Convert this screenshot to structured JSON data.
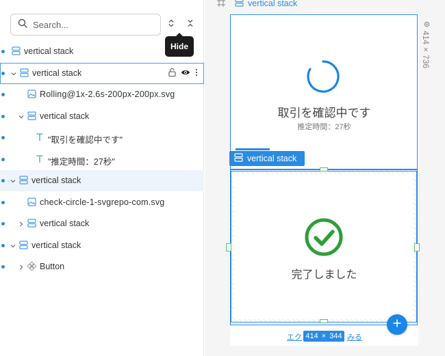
{
  "search": {
    "placeholder": "Search..."
  },
  "tooltip": "Hide",
  "tree": [
    {
      "label": "vertical stack",
      "icon": "stack-icon"
    },
    {
      "label": "vertical stack",
      "icon": "stack-icon"
    },
    {
      "label": "Rolling@1x-2.6s-200px-200px.svg",
      "icon": "image-icon"
    },
    {
      "label": "vertical stack",
      "icon": "stack-icon"
    },
    {
      "label": "\"取引を確認中です\"",
      "icon": "text-icon"
    },
    {
      "label": "\"推定時間：27秒\"",
      "icon": "text-icon"
    },
    {
      "label": "vertical stack",
      "icon": "stack-icon"
    },
    {
      "label": "check-circle-1-svgrepo-com.svg",
      "icon": "image-icon"
    },
    {
      "label": "vertical stack",
      "icon": "stack-icon"
    },
    {
      "label": "vertical stack",
      "icon": "stack-icon"
    },
    {
      "label": "Button",
      "icon": "component-icon"
    }
  ],
  "canvas": {
    "frame_label": "vertical stack",
    "frame_w": "414",
    "frame_x": "×",
    "frame_h": "736",
    "loading_title": "取引を確認中です",
    "loading_sub": "推定時間：27秒",
    "badge_label": "vertical stack",
    "done_title": "完了しました",
    "size_w": "414",
    "size_x": "×",
    "size_h": "344",
    "link_left": "エク",
    "link_right": "みる"
  },
  "colors": {
    "accent": "#2a8be3",
    "success": "#2e9e3a"
  }
}
